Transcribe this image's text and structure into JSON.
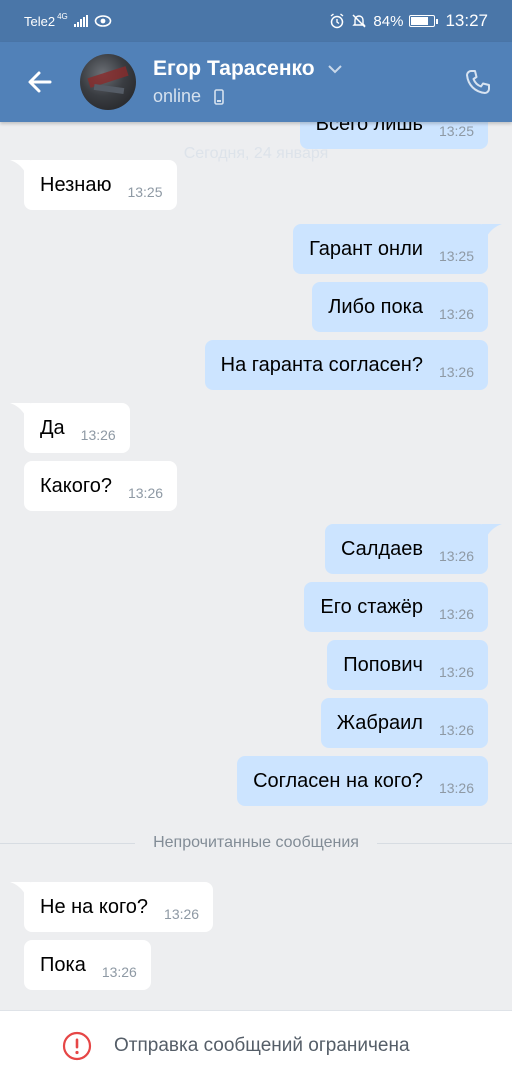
{
  "status_bar": {
    "carrier": "Tele2",
    "network": "4G",
    "battery": "84%",
    "battery_level": 0.84,
    "time": "13:27"
  },
  "header": {
    "contact_name": "Егор Тарасенко",
    "status": "online"
  },
  "date_separator": "Сегодня, 24 января",
  "messages": [
    {
      "direction": "out",
      "text": "Всего лишь",
      "time": "13:25"
    },
    {
      "direction": "in",
      "text": "Незнаю",
      "time": "13:25"
    },
    {
      "direction": "out",
      "text": "Гарант онли",
      "time": "13:25"
    },
    {
      "direction": "out",
      "text": "Либо пока",
      "time": "13:26"
    },
    {
      "direction": "out",
      "text": "На гаранта согласен?",
      "time": "13:26"
    },
    {
      "direction": "in",
      "text": "Да",
      "time": "13:26"
    },
    {
      "direction": "in",
      "text": "Какого?",
      "time": "13:26"
    },
    {
      "direction": "out",
      "text": "Салдаев",
      "time": "13:26"
    },
    {
      "direction": "out",
      "text": "Его стажёр",
      "time": "13:26"
    },
    {
      "direction": "out",
      "text": "Попович",
      "time": "13:26"
    },
    {
      "direction": "out",
      "text": "Жабраил",
      "time": "13:26"
    },
    {
      "direction": "out",
      "text": "Согласен на кого?",
      "time": "13:26"
    },
    {
      "direction": "in",
      "text": "Не на кого?",
      "time": "13:26"
    },
    {
      "direction": "in",
      "text": "Пока",
      "time": "13:26"
    }
  ],
  "unread_separator": "Непрочитанные сообщения",
  "footer": {
    "notice": "Отправка сообщений ограничена"
  },
  "colors": {
    "header": "#5181b8",
    "status_bar": "#4a76a8",
    "outgoing_bubble": "#cce4ff",
    "incoming_bubble": "#ffffff",
    "background": "#edeef0",
    "warning": "#e64646"
  }
}
